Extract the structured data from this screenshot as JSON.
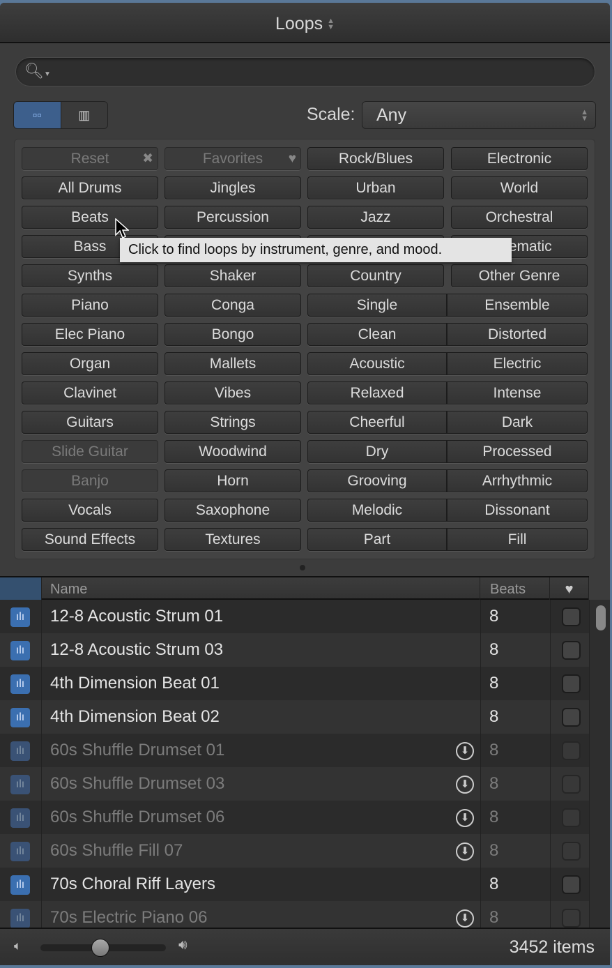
{
  "title": "Loops",
  "search": {
    "placeholder": "",
    "icon": "search-icon"
  },
  "view": {
    "selected": "button-view"
  },
  "scale": {
    "label": "Scale:",
    "value": "Any"
  },
  "grid": [
    [
      {
        "l": "Reset",
        "dim": true,
        "sfx": "✖"
      },
      {
        "l": "Favorites",
        "dim": true,
        "sfx": "♥"
      },
      {
        "l": "Rock/Blues"
      },
      {
        "l": "Electronic"
      }
    ],
    [
      {
        "l": "All Drums"
      },
      {
        "l": "Jingles"
      },
      {
        "l": "Urban"
      },
      {
        "l": "World"
      }
    ],
    [
      {
        "l": "Beats"
      },
      {
        "l": "Percussion"
      },
      {
        "l": "Jazz"
      },
      {
        "l": "Orchestral"
      }
    ],
    [
      {
        "l": "Bass"
      },
      {
        "l": ""
      },
      {
        "l": ""
      },
      {
        "l": "Cinematic"
      }
    ],
    [
      {
        "l": "Synths"
      },
      {
        "l": "Shaker"
      },
      {
        "l": "Country"
      },
      {
        "l": "Other Genre"
      }
    ],
    [
      {
        "l": "Piano"
      },
      {
        "l": "Conga"
      },
      {
        "l": "Single"
      },
      {
        "l": "Ensemble"
      }
    ],
    [
      {
        "l": "Elec Piano"
      },
      {
        "l": "Bongo"
      },
      {
        "l": "Clean"
      },
      {
        "l": "Distorted"
      }
    ],
    [
      {
        "l": "Organ"
      },
      {
        "l": "Mallets"
      },
      {
        "l": "Acoustic"
      },
      {
        "l": "Electric"
      }
    ],
    [
      {
        "l": "Clavinet"
      },
      {
        "l": "Vibes"
      },
      {
        "l": "Relaxed"
      },
      {
        "l": "Intense"
      }
    ],
    [
      {
        "l": "Guitars"
      },
      {
        "l": "Strings"
      },
      {
        "l": "Cheerful"
      },
      {
        "l": "Dark"
      }
    ],
    [
      {
        "l": "Slide Guitar",
        "dim": true
      },
      {
        "l": "Woodwind"
      },
      {
        "l": "Dry"
      },
      {
        "l": "Processed"
      }
    ],
    [
      {
        "l": "Banjo",
        "dim": true
      },
      {
        "l": "Horn"
      },
      {
        "l": "Grooving"
      },
      {
        "l": "Arrhythmic"
      }
    ],
    [
      {
        "l": "Vocals"
      },
      {
        "l": "Saxophone"
      },
      {
        "l": "Melodic"
      },
      {
        "l": "Dissonant"
      }
    ],
    [
      {
        "l": "Sound Effects"
      },
      {
        "l": "Textures"
      },
      {
        "l": "Part"
      },
      {
        "l": "Fill"
      }
    ]
  ],
  "tooltip": "Click to find loops by instrument, genre, and mood.",
  "list": {
    "headers": {
      "name": "Name",
      "beats": "Beats",
      "fav": "♥"
    },
    "rows": [
      {
        "name": "12-8 Acoustic Strum 01",
        "beats": "8",
        "dim": false
      },
      {
        "name": "12-8 Acoustic Strum 03",
        "beats": "8",
        "dim": false
      },
      {
        "name": "4th Dimension Beat 01",
        "beats": "8",
        "dim": false
      },
      {
        "name": "4th Dimension Beat 02",
        "beats": "8",
        "dim": false
      },
      {
        "name": "60s Shuffle Drumset 01",
        "beats": "8",
        "dim": true
      },
      {
        "name": "60s Shuffle Drumset 03",
        "beats": "8",
        "dim": true
      },
      {
        "name": "60s Shuffle Drumset 06",
        "beats": "8",
        "dim": true
      },
      {
        "name": "60s Shuffle Fill 07",
        "beats": "8",
        "dim": true
      },
      {
        "name": "70s Choral Riff Layers",
        "beats": "8",
        "dim": false
      },
      {
        "name": "70s Electric Piano 06",
        "beats": "8",
        "dim": true
      }
    ]
  },
  "footer": {
    "volume": 0.48,
    "count": "3452 items"
  }
}
